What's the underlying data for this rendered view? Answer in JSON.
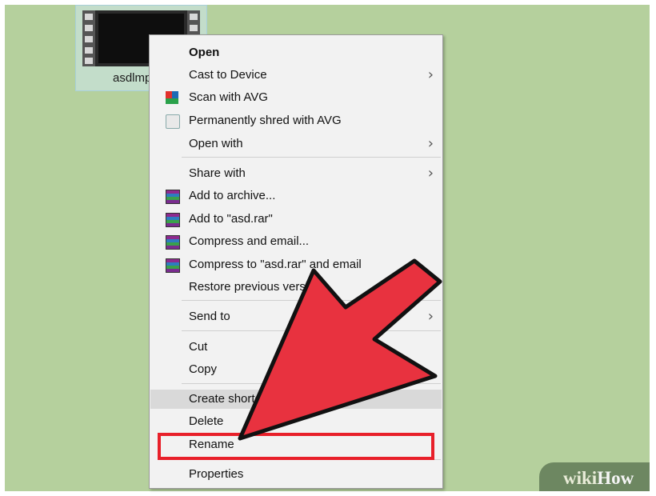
{
  "file": {
    "label": "asdlmp"
  },
  "menu": {
    "items": [
      {
        "label": "Open",
        "bold": true
      },
      {
        "label": "Cast to Device",
        "submenu": true
      },
      {
        "label": "Scan with AVG",
        "icon": "avg-icon"
      },
      {
        "label": "Permanently shred with AVG",
        "icon": "shred-icon"
      },
      {
        "label": "Open with",
        "submenu": true
      },
      {
        "label": "Share with",
        "submenu": true
      },
      {
        "label": "Add to archive...",
        "icon": "winrar-icon"
      },
      {
        "label": "Add to \"asd.rar\"",
        "icon": "winrar-icon"
      },
      {
        "label": "Compress and email...",
        "icon": "winrar-icon"
      },
      {
        "label": "Compress to \"asd.rar\" and email",
        "icon": "winrar-icon"
      },
      {
        "label": "Restore previous versions"
      },
      {
        "label": "Send to",
        "submenu": true
      },
      {
        "label": "Cut"
      },
      {
        "label": "Copy"
      },
      {
        "label": "Create shortcut",
        "highlighted": true
      },
      {
        "label": "Delete"
      },
      {
        "label": "Rename"
      },
      {
        "label": "Properties"
      }
    ],
    "chevron": "›"
  },
  "colors": {
    "highlight": "#e8202a",
    "arrow": "#e8323f",
    "desktop": "#b5d09d"
  },
  "watermark": {
    "text_a": "wiki",
    "text_b": "How"
  }
}
